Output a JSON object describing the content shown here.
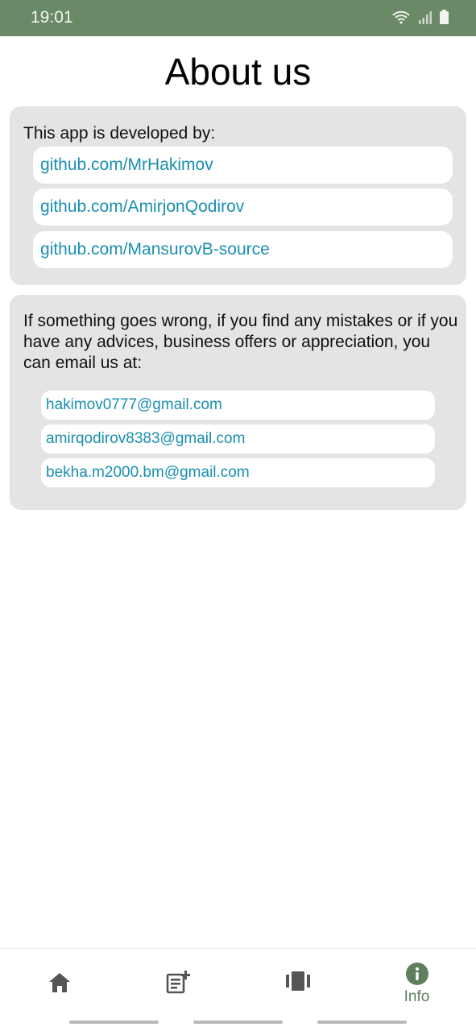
{
  "status_bar": {
    "time": "19:01",
    "icons": [
      "wifi-icon",
      "signal-icon",
      "battery-icon"
    ],
    "background": "#6a8a67"
  },
  "page": {
    "title": "About us"
  },
  "developers": {
    "heading": "This app is developed by:",
    "links": [
      "github.com/MrHakimov",
      "github.com/AmirjonQodirov",
      "github.com/MansurovB-source"
    ]
  },
  "contact": {
    "message": "If something goes wrong, if you find any mistakes or if you have any advices, business offers or appreciation, you can email us at:",
    "emails": [
      "hakimov0777@gmail.com",
      "amirqodirov8383@gmail.com",
      "bekha.m2000.bm@gmail.com"
    ]
  },
  "bottom_nav": {
    "items": [
      {
        "icon": "home-icon",
        "label": ""
      },
      {
        "icon": "add-note-icon",
        "label": ""
      },
      {
        "icon": "cards-icon",
        "label": ""
      },
      {
        "icon": "info-icon",
        "label": "Info",
        "active": true
      }
    ],
    "active_color": "#5f7e5c",
    "inactive_color": "#555555"
  },
  "colors": {
    "link": "#1a8fb0",
    "card": "#e4e4e4"
  }
}
